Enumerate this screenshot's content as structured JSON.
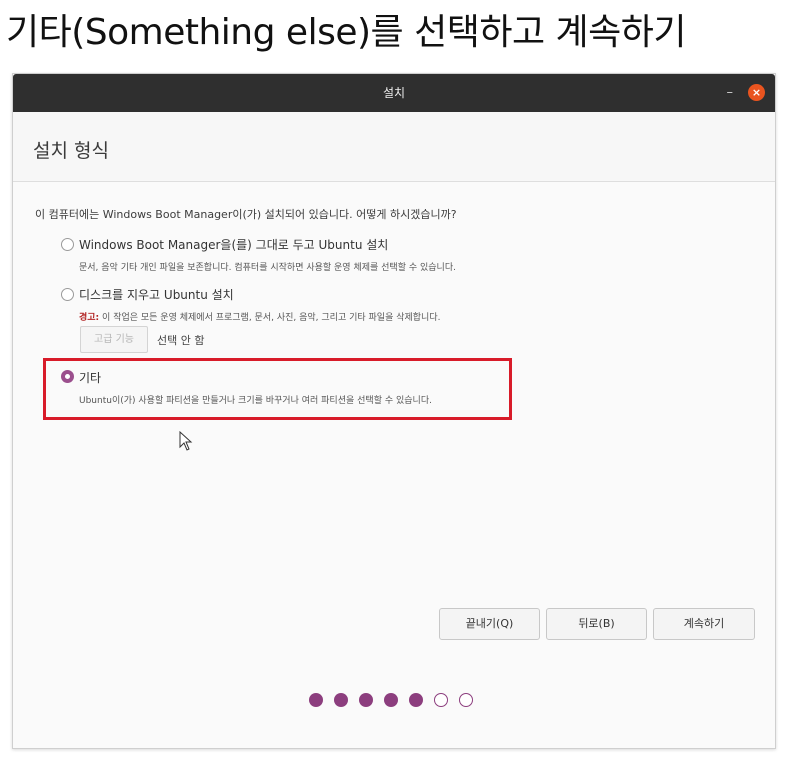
{
  "heading": "기타(Something else)를 선택하고 계속하기",
  "window": {
    "title": "설치",
    "minimize_glyph": "–",
    "close_glyph": "×"
  },
  "page": {
    "title": "설치 형식",
    "question": "이 컴퓨터에는 Windows Boot Manager이(가) 설치되어 있습니다. 어떻게 하시겠습니까?"
  },
  "options": [
    {
      "label": "Windows Boot Manager을(를) 그대로 두고 Ubuntu 설치",
      "description": "문서, 음악 기타 개인 파일을 보존합니다. 컴퓨터를 시작하면 사용할 운영 체제를 선택할 수 있습니다.",
      "selected": false
    },
    {
      "label": "디스크를 지우고 Ubuntu 설치",
      "warning_prefix": "경고:",
      "description": "이 작업은 모든 운영 체제에서 프로그램, 문서, 사진, 음악, 그리고 기타 파일을 삭제합니다.",
      "selected": false
    },
    {
      "label": "기타",
      "description": "Ubuntu이(가) 사용할 파티션을 만들거나 크기를 바꾸거나 여러 파티션을 선택할 수 있습니다.",
      "selected": true
    }
  ],
  "advanced": {
    "button_label": "고급 기능",
    "status": "선택 안 함"
  },
  "buttons": {
    "quit": "끝내기(Q)",
    "back": "뒤로(B)",
    "continue": "계속하기"
  },
  "progress": {
    "total_steps": 7,
    "completed_steps": 5
  },
  "colors": {
    "accent": "#8c3e7e",
    "highlight_box": "#d81b29",
    "titlebar": "#2f2f2f",
    "close_button": "#e9541f",
    "warning": "#b22222"
  }
}
